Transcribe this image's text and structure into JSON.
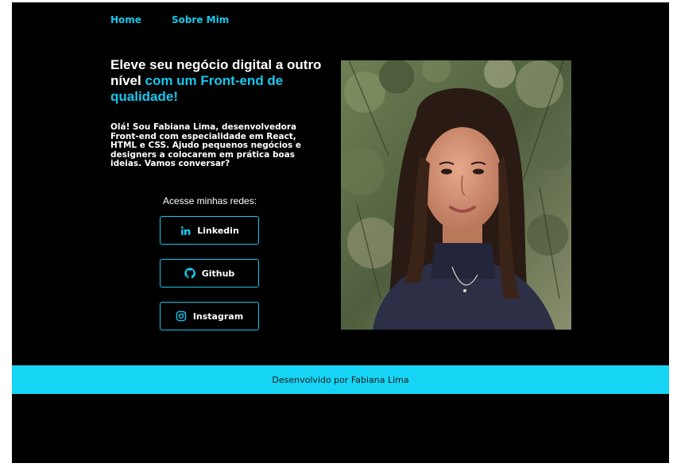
{
  "nav": {
    "items": [
      {
        "label": "Home"
      },
      {
        "label": "Sobre Mim"
      }
    ]
  },
  "hero": {
    "headline_plain": "Eleve seu negócio digital a outro nível",
    "headline_accent": "com um Front-end de qualidade!",
    "bio": "Olá! Sou Fabiana Lima, desenvolvedora Front-end com especialidade em React, HTML e CSS. Ajudo pequenos negócios e designers a colocarem em prática boas ideias. Vamos conversar?",
    "social_label": "Acesse minhas redes:",
    "social_links": [
      {
        "label": "Linkedin",
        "icon": "linkedin-icon"
      },
      {
        "label": "Github",
        "icon": "github-icon"
      },
      {
        "label": "Instagram",
        "icon": "instagram-icon"
      }
    ]
  },
  "footer": {
    "text": "Desenvolvido por Fabiana Lima"
  },
  "colors": {
    "background": "#000000",
    "accent": "#16c7ee",
    "footer_bg": "#16d4f3",
    "text": "#ffffff"
  }
}
